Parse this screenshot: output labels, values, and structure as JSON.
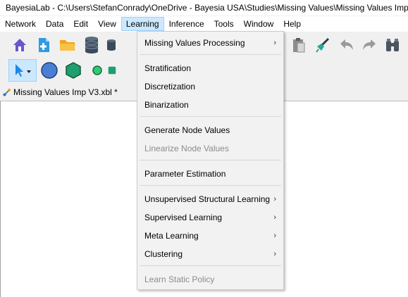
{
  "window": {
    "title": "BayesiaLab - C:\\Users\\StefanConrady\\OneDrive - Bayesia USA\\Studies\\Missing Values\\Missing Values Imp"
  },
  "menubar": {
    "items": [
      "Network",
      "Data",
      "Edit",
      "View",
      "Learning",
      "Inference",
      "Tools",
      "Window",
      "Help"
    ],
    "active": "Learning"
  },
  "toolbar": {
    "icons": [
      "home-icon",
      "new-file-icon",
      "open-folder-icon",
      "database-icon",
      "database-2-icon",
      "clipboard-icon",
      "broom-icon",
      "undo-icon",
      "redo-icon",
      "binoculars-icon",
      "selection-arrow-icon",
      "circle-node-icon",
      "hexagon-node-icon",
      "small-circle-node-icon"
    ]
  },
  "document_tab": {
    "label": "Missing Values Imp V3.xbl *"
  },
  "learning_menu": {
    "items": [
      {
        "label": "Missing Values Processing",
        "submenu": true,
        "enabled": true
      },
      {
        "label": "Stratification",
        "submenu": false,
        "enabled": true
      },
      {
        "label": "Discretization",
        "submenu": false,
        "enabled": true
      },
      {
        "label": "Binarization",
        "submenu": false,
        "enabled": true
      },
      {
        "label": "Generate Node Values",
        "submenu": false,
        "enabled": true
      },
      {
        "label": "Linearize Node Values",
        "submenu": false,
        "enabled": false
      },
      {
        "label": "Parameter Estimation",
        "submenu": false,
        "enabled": true
      },
      {
        "label": "Unsupervised Structural Learning",
        "submenu": true,
        "enabled": true
      },
      {
        "label": "Supervised Learning",
        "submenu": true,
        "enabled": true
      },
      {
        "label": "Meta Learning",
        "submenu": true,
        "enabled": true
      },
      {
        "label": "Clustering",
        "submenu": true,
        "enabled": true
      },
      {
        "label": "Learn Static Policy",
        "submenu": false,
        "enabled": false
      }
    ],
    "submenu_arrow": "›"
  }
}
